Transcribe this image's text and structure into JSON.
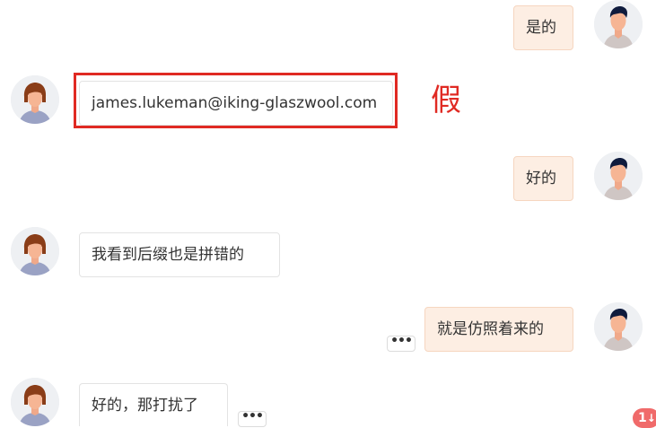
{
  "messages": [
    {
      "side": "sent",
      "text": "是的"
    },
    {
      "side": "received",
      "text": "james.lukeman@iking-glaszwool.com"
    },
    {
      "side": "sent",
      "text": "好的"
    },
    {
      "side": "received",
      "text": "我看到后缀也是拼错的"
    },
    {
      "side": "sent",
      "text": "就是仿照着来的"
    },
    {
      "side": "received",
      "text": "好的，那打扰了"
    }
  ],
  "annotation": {
    "text": "假",
    "color": "#e02a23"
  },
  "more_label": "•••",
  "unread_badge": {
    "count": "1",
    "arrow": "↓"
  },
  "colors": {
    "sent_bubble": "#fdeee3",
    "received_bubble": "#ffffff",
    "highlight": "#e02a23",
    "badge": "#f06a6a"
  },
  "icons": {
    "self_avatar": "male-avatar-icon",
    "contact_avatar": "female-avatar-icon",
    "more": "ellipsis-icon",
    "scroll_down": "down-arrow-icon"
  }
}
